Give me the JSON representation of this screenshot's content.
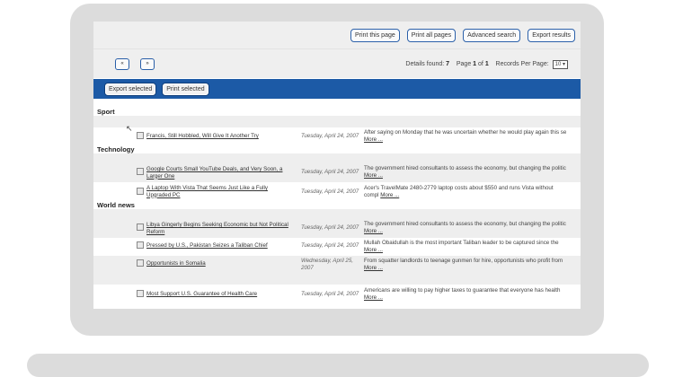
{
  "toolbar": {
    "print_page": "Print this page",
    "print_all": "Print all pages",
    "advanced_search": "Advanced search",
    "export_results": "Export results"
  },
  "pager": {
    "first_label": "«",
    "last_label": "»",
    "details_label": "Details found:",
    "details_count": "7",
    "page_label": "Page",
    "page_current": "1",
    "of_label": "of",
    "page_total": "1",
    "records_label": "Records Per Page:",
    "records_value": "10"
  },
  "actions": {
    "export_selected": "Export selected",
    "print_selected": "Print selected"
  },
  "groups": {
    "sport": "Sport",
    "technology": "Technology",
    "world_news": "World news"
  },
  "rows": [
    {
      "title": "Francis, Still Hobbled, Will Give It Another Try",
      "date": "Tuesday, April 24, 2007",
      "desc": "After saying on Monday that he was uncertain whether he would play again this se",
      "more": "More ..."
    },
    {
      "title": "Google Courts Small YouTube Deals, and Very Soon, a Larger One",
      "date": "Tuesday, April 24, 2007",
      "desc": "The government hired consultants to assess the economy, but changing the politic",
      "more": "More ..."
    },
    {
      "title": "A Laptop With Vista That Seems Just Like a Fully Upgraded PC",
      "date": "Tuesday, April 24, 2007",
      "desc": "Acer's TravelMate 2480-2779 laptop costs about $550 and runs Vista without compl",
      "more": "More ..."
    },
    {
      "title": "Libya Gingerly Begins Seeking Economic but Not Political Reform",
      "date": "Tuesday, April 24, 2007",
      "desc": "The government hired consultants to assess the economy, but changing the politic",
      "more": "More ..."
    },
    {
      "title": "Pressed by U.S., Pakistan Seizes a Taliban Chief",
      "date": "Tuesday, April 24, 2007",
      "desc": "Mullah Obaidullah is the most important Taliban leader to be captured since the",
      "more": "More ..."
    },
    {
      "title": "Opportunists in Somalia",
      "date": "Wednesday, April 25, 2007",
      "desc": "From squatter landlords to teenage gunmen for hire, opportunists who profit from",
      "more": "More ..."
    },
    {
      "title": "Most Support U.S. Guarantee of Health Care",
      "date": "Tuesday, April 24, 2007",
      "desc": "Americans are willing to pay higher taxes to guarantee that everyone has health",
      "more": "More ..."
    }
  ]
}
